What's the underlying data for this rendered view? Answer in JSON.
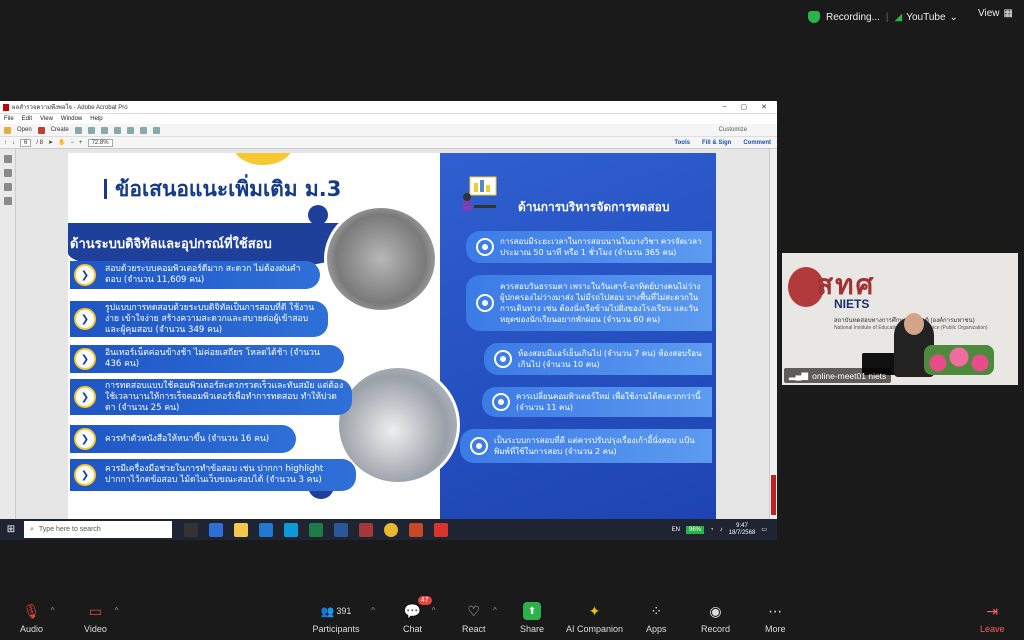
{
  "zoom_top": {
    "recording": "Recording...",
    "youtube": "YouTube",
    "view": "View"
  },
  "acrobat": {
    "title": "ผลสำรวจความพึงพอใจ - Adobe Acrobat Pro",
    "menu": [
      "File",
      "Edit",
      "View",
      "Window",
      "Help"
    ],
    "open": "Open",
    "create": "Create",
    "customize": "Customize",
    "page_current": "6",
    "page_total": "/ 8",
    "zoom": "72.8%",
    "tools": "Tools",
    "fill_sign": "Fill & Sign",
    "comment": "Comment"
  },
  "slide": {
    "title": "ข้อเสนอแนะเพิ่มเติม ม.3",
    "left_heading": "ด้านระบบดิจิทัลและอุปกรณ์ที่ใช้สอบ",
    "right_heading": "ด้านการบริหารจัดการทดสอบ",
    "left_items": [
      "สอบด้วยระบบคอมพิวเตอร์ดีมาก สะดวก ไม่ต้องฝนคำตอบ (จำนวน 11,609 คน)",
      "รูปแบบการทดสอบด้วยระบบดิจิทัลเป็นการสอบที่ดี ใช้งานง่าย เข้าใจง่าย สร้างความสะดวกและสบายต่อผู้เข้าสอบและผู้คุมสอบ (จำนวน 349 คน)",
      "อินเทอร์เน็ตค่อนข้างช้า ไม่ค่อยเสถียร โหลดได้ช้า (จำนวน 436 คน)",
      "การทดสอบแบบใช้คอมพิวเตอร์สะดวกรวดเร็วและทันสมัย แต่ต้องใช้เวลานานให้การเร็จคอมพิวเตอร์เพื่อทำการทดสอบ ทำให้ปวดตา (จำนวน 25 คน)",
      "ควรทำตัวหนังสือให้หนาขึ้น (จำนวน 16 คน)",
      "ควรมีเครื่องมือช่วยในการทำข้อสอบ เช่น ปากกา highlight ปากกาไว้กดข้อสอบ ไม้ดไนเว็บขณะสอบได้ (จำนวน 3 คน)"
    ],
    "right_items": [
      "การสอบมีระยะเวลาในการสอบนานในบางวิชา ควรจัดเวลาประมาณ 50 นาที หรือ 1 ชั่วโมง (จำนวน 365 คน)",
      "ควรสอบวันธรรมดา เพราะในวันเสาร์-อาทิตย์บางคนไม่ว่าง ผู้ปกครองไม่ว่างมาส่ง ไม่มีรถไปสอบ บางพื้นที่ไม่สะดวกในการเดินทาง เช่น ต้องนั่งเรือข้ามไปฝั่งของโรงเรียน และวันหยุดของนักเรียนอยากพักผ่อน (จำนวน 60 คน)",
      "ห้องสอบมีแอร์เย็นเกินไป (จำนวน 7 คน) ห้องสอบร้อนเกินไป (จำนวน 10 คน)",
      "ควรเปลี่ยนคอมพิวเตอร์ใหม่ เพื่อใช้งานได้สะดวกกว่านี้ (จำนวน 11 คน)",
      "เป็นระบบการสอบที่ดี แต่ควรปรับปรุงเรื่องเก้าอี้นั่งสอบ แป้นพิมพ์ที่ใช้ในการสอบ (จำนวน 2 คน)"
    ]
  },
  "taskbar": {
    "search_placeholder": "Type here to search",
    "lang": "EN",
    "battery": "96%",
    "time": "9:47",
    "date": "18/7/2568"
  },
  "video": {
    "logo_text": "สทศ",
    "niets": "NIETS",
    "org_line": "สถาบันทดสอบทางการศึกษาแห่งชาติ (องค์การมหาชน)",
    "org_line2": "National Institute of Educational Testing Service (Public Organization)",
    "participant": "online-meet01 niets"
  },
  "controls": {
    "audio": "Audio",
    "video": "Video",
    "participants": "Participants",
    "participants_count": "391",
    "chat": "Chat",
    "chat_badge": "47",
    "react": "React",
    "share": "Share",
    "ai": "AI Companion",
    "apps": "Apps",
    "record": "Record",
    "more": "More",
    "leave": "Leave"
  }
}
